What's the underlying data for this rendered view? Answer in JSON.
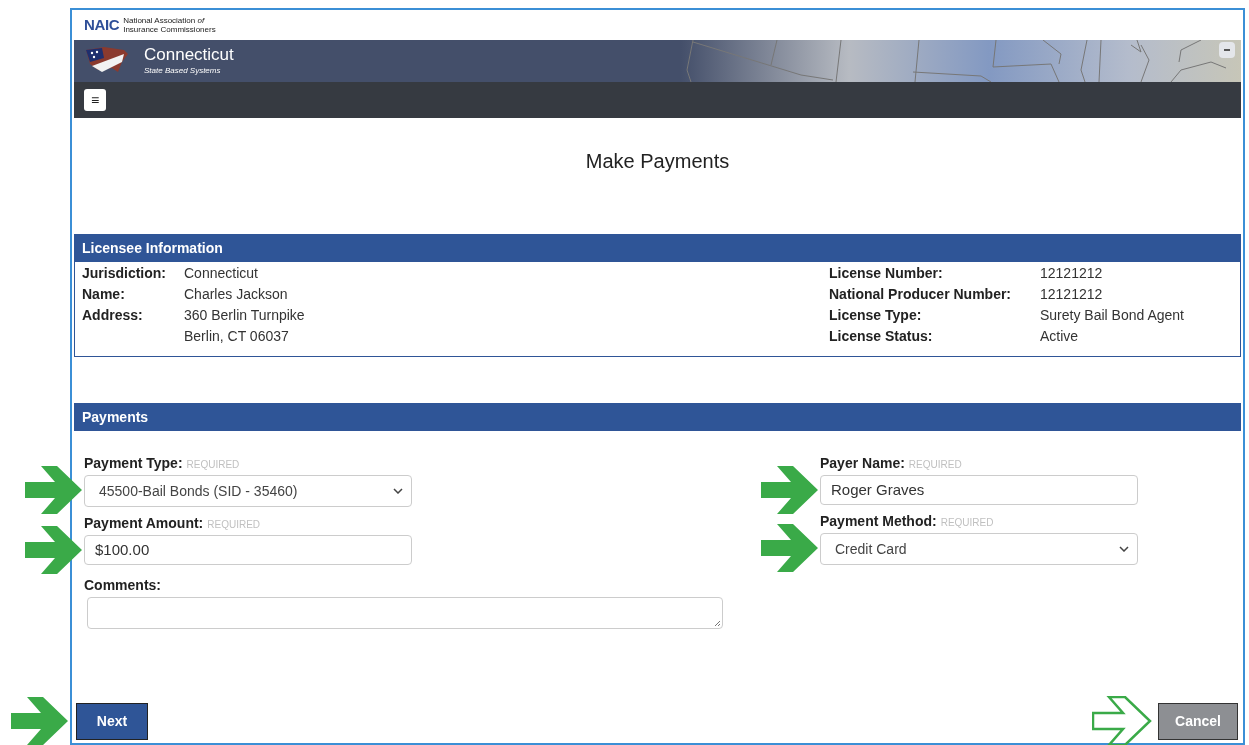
{
  "header": {
    "logo_abbr": "NAIC",
    "logo_line_1": "National Association *of*",
    "logo_line_2": "Insurance Commissioners",
    "state": "Connecticut",
    "subtitle": "State Based Systems",
    "menu_button": "≡"
  },
  "page_title": "Make Payments",
  "licensee": {
    "title": "Licensee Information",
    "left": [
      {
        "label": "Jurisdiction:",
        "lines": [
          "Connecticut"
        ]
      },
      {
        "label": "Name:",
        "lines": [
          "Charles Jackson"
        ]
      },
      {
        "label": "Address:",
        "lines": [
          "360 Berlin Turnpike",
          "Berlin, CT 06037"
        ]
      }
    ],
    "right": [
      {
        "label": "License Number:",
        "lines": [
          "12121212"
        ]
      },
      {
        "label": "National Producer Number:",
        "lines": [
          "12121212"
        ]
      },
      {
        "label": "License Type:",
        "lines": [
          "Surety Bail Bond Agent"
        ]
      },
      {
        "label": "License Status:",
        "lines": [
          "Active"
        ]
      }
    ]
  },
  "payments": {
    "title": "Payments",
    "left_fields": [
      {
        "label": "Payment Type:",
        "note": "REQUIRED",
        "kind": "select",
        "value": "45500-Bail Bonds (SID - 35460)",
        "arrow": {
          "kind": "filled"
        }
      },
      {
        "label": "Payment Amount:",
        "note": "REQUIRED",
        "kind": "input",
        "value": "$100.00",
        "arrow": {
          "kind": "filled"
        }
      }
    ],
    "right_fields": [
      {
        "label": "Payer Name:",
        "note": "REQUIRED",
        "kind": "input",
        "value": "Roger Graves",
        "arrow": {
          "kind": "filled"
        }
      },
      {
        "label": "Payment Method:",
        "note": "REQUIRED",
        "kind": "select",
        "value": "Credit Card",
        "arrow": {
          "kind": "filled"
        }
      }
    ],
    "comments": {
      "label": "Comments:",
      "kind": "textarea"
    }
  },
  "buttons": [
    {
      "label": "Next",
      "kind": "primary",
      "arrow": {
        "kind": "filled"
      }
    },
    {
      "label": "Cancel",
      "kind": "secondary",
      "arrow": {
        "kind": "outline"
      }
    }
  ]
}
